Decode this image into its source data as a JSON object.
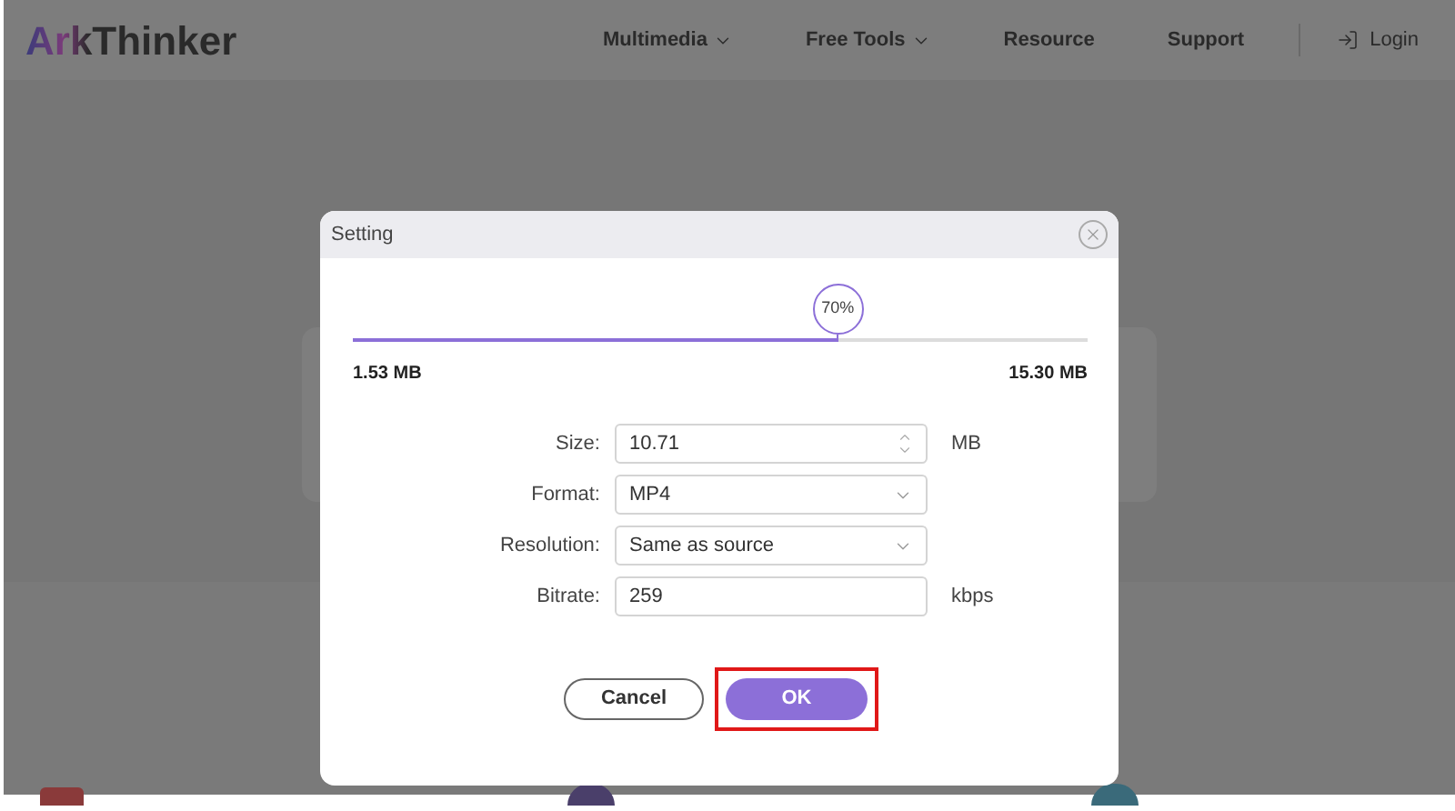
{
  "logo": "ArkThinker",
  "nav": [
    {
      "label": "Multimedia",
      "dropdown": true
    },
    {
      "label": "Free Tools",
      "dropdown": true
    },
    {
      "label": "Resource",
      "dropdown": false
    },
    {
      "label": "Support",
      "dropdown": false
    }
  ],
  "login": "Login",
  "dialog": {
    "title": "Setting",
    "slider": {
      "level": 0.66,
      "reading": "70%",
      "min_label": "1.53 MB",
      "max_label": "15.30 MB"
    },
    "fields": [
      {
        "kind": "spinner",
        "label": "Size:",
        "value": "10.71",
        "unit": "MB"
      },
      {
        "kind": "select",
        "label": "Format:",
        "value": "MP4"
      },
      {
        "kind": "select",
        "label": "Resolution:",
        "value": "Same as source"
      },
      {
        "kind": "text",
        "label": "Bitrate:",
        "value": "259",
        "unit": "kbps"
      }
    ],
    "buttons": [
      {
        "label": "Cancel",
        "kind": "secondary",
        "highlighted": false
      },
      {
        "label": "OK",
        "kind": "primary",
        "highlighted": true
      }
    ]
  }
}
